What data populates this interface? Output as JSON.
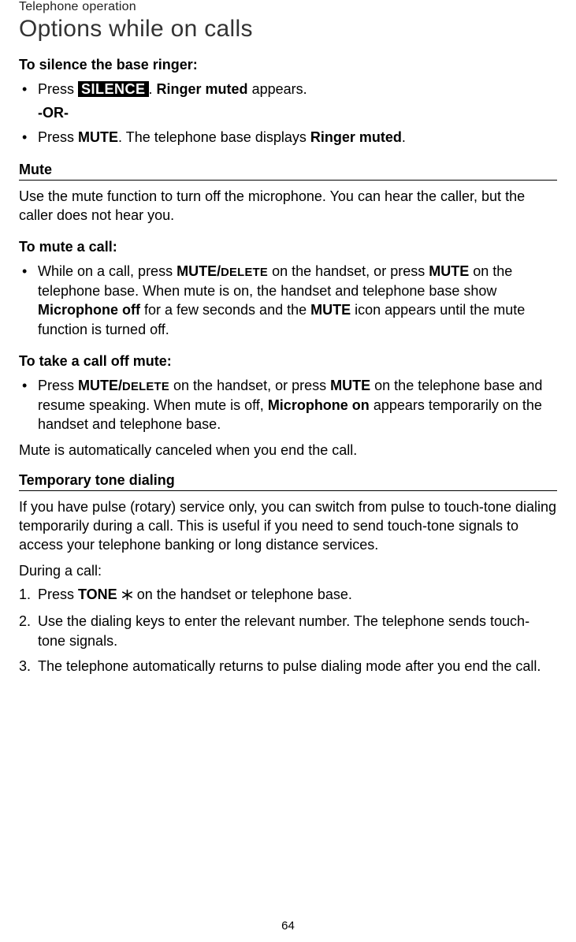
{
  "chapter": "Telephone operation",
  "title": "Options while on calls",
  "silence": {
    "heading": "To silence the base ringer:",
    "b1_pre": "Press ",
    "b1_btn": "SILENCE",
    "b1_mid": ". ",
    "b1_bold": "Ringer muted",
    "b1_post": " appears.",
    "or": "-OR-",
    "b2_pre": "Press ",
    "b2_bold1": "MUTE",
    "b2_mid": ". The telephone base displays ",
    "b2_bold2": "Ringer muted",
    "b2_post": "."
  },
  "mute": {
    "heading": "Mute",
    "intro": "Use the mute function to turn off the microphone. You can hear the caller, but the caller does not hear you.",
    "sub1": "To mute a call:",
    "b1_pre": "While on a call, press ",
    "b1_md1": "MUTE/",
    "b1_md1s": "DELETE",
    "b1_mid1": " on the handset, or press ",
    "b1_md2": "MUTE",
    "b1_mid2": " on the telephone base. When mute is on, the handset and telephone base show ",
    "b1_md3": "Microphone off",
    "b1_mid3": " for a few seconds and the ",
    "b1_md4": "MUTE",
    "b1_post": " icon appears until the mute function is turned off.",
    "sub2": "To take a call off mute:",
    "b2_pre": "Press ",
    "b2_md1": "MUTE/",
    "b2_md1s": "DELETE",
    "b2_mid1": " on the handset, or press ",
    "b2_md2": "MUTE",
    "b2_mid2": " on the telephone base and resume speaking. When mute is off, ",
    "b2_md3": "Microphone on",
    "b2_post": " appears temporarily on the handset and telephone base.",
    "note": "Mute is automatically canceled when you end the call."
  },
  "tone": {
    "heading": "Temporary tone dialing",
    "intro": "If you have pulse (rotary) service only, you can switch from pulse to touch-tone dialing temporarily during a call. This is useful if you need to send touch-tone signals to access your telephone banking or long distance services.",
    "during": "During a call:",
    "l1_pre": "Press ",
    "l1_bold": "TONE",
    "l1_post": " on the handset or telephone base.",
    "l2": "Use the dialing keys to enter the relevant number. The telephone sends touch-tone signals.",
    "l3": "The telephone automatically returns to pulse dialing mode after you end the call."
  },
  "page": "64"
}
